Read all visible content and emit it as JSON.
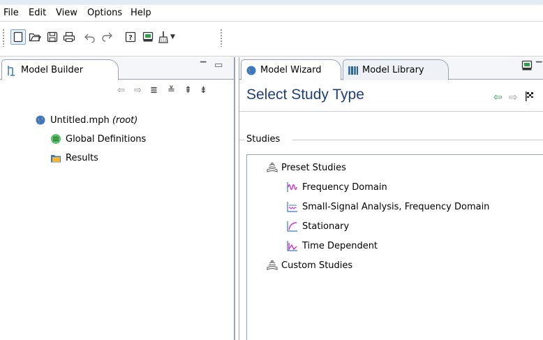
{
  "menu": [
    "File",
    "Edit",
    "View",
    "Options",
    "Help"
  ],
  "left_panel": {
    "tab_label": "Model Builder",
    "tree": {
      "root_name": "Untitled.mph",
      "root_suffix": "(root)",
      "children": [
        "Global Definitions",
        "Results"
      ]
    }
  },
  "right_panel": {
    "tabs": [
      "Model Wizard",
      "Model Library"
    ],
    "heading": "Select Study Type",
    "group_label": "Studies",
    "studies": {
      "preset_label": "Preset Studies",
      "preset_items": [
        "Frequency Domain",
        "Small-Signal Analysis, Frequency Domain",
        "Stationary",
        "Time Dependent"
      ],
      "custom_label": "Custom Studies"
    }
  },
  "icons": {
    "toolbar": [
      "new-file-icon",
      "open-folder-icon",
      "save-icon",
      "print-icon",
      "undo-icon",
      "redo-icon",
      "help-icon",
      "dynamic-help-icon",
      "broom-icon",
      "dropdown-arrow-icon"
    ],
    "navigation": [
      "back-arrow-icon",
      "forward-arrow-icon",
      "finish-flag-icon"
    ]
  },
  "colors": {
    "heading": "#1f3f7a",
    "accent_blue": "#3a78c4",
    "nav_green": "#2e9f4a"
  }
}
